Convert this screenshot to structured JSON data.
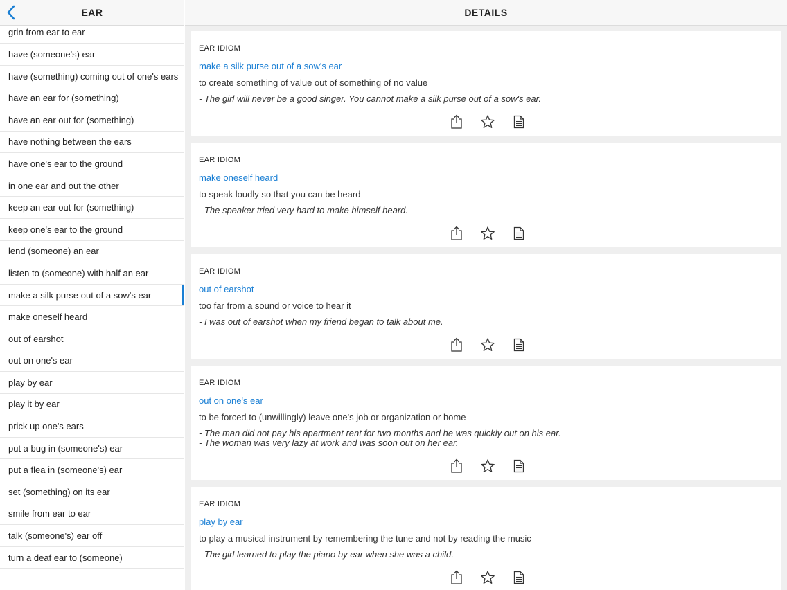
{
  "left_panel": {
    "title": "EAR",
    "items": [
      "grin from ear to ear",
      "have (someone's) ear",
      "have (something) coming out of one's ears",
      "have an ear for (something)",
      "have an ear out for (something)",
      "have nothing between the ears",
      "have one's ear to the ground",
      "in one ear and out the other",
      "keep an ear out for (something)",
      "keep one's ear to the ground",
      "lend (someone) an ear",
      "listen to (someone) with half an ear",
      "make a silk purse out of a sow's ear",
      "make oneself heard",
      "out of earshot",
      "out on one's ear",
      "play by ear",
      "play it by ear",
      "prick up one's ears",
      "put a bug in (someone's) ear",
      "put a flea in (someone's) ear",
      "set (something) on its ear",
      "smile from ear to ear",
      "talk (someone's) ear off",
      "turn a deaf ear to (someone)"
    ],
    "selected_index": 12
  },
  "right_panel": {
    "title": "DETAILS",
    "cards": [
      {
        "tag": "EAR IDIOM",
        "title": "make a silk purse out of a sow's ear",
        "definition": "to create something of value out of something of no value",
        "examples": [
          "- The girl will never be a good singer. You cannot make a silk purse out of a sow's ear."
        ]
      },
      {
        "tag": "EAR IDIOM",
        "title": "make oneself heard",
        "definition": "to speak loudly so that you can be heard",
        "examples": [
          "- The speaker tried very hard to make himself heard."
        ]
      },
      {
        "tag": "EAR IDIOM",
        "title": "out of earshot",
        "definition": "too far from a sound or voice to hear it",
        "examples": [
          "- I was out of earshot when my friend began to talk about me."
        ]
      },
      {
        "tag": "EAR IDIOM",
        "title": "out on one's ear",
        "definition": "to be forced to (unwillingly) leave one's job or organization or home",
        "examples": [
          "- The man did not pay his apartment rent for two months and he was quickly out on his ear.",
          "- The woman was very lazy at work and was soon out on her ear."
        ]
      },
      {
        "tag": "EAR IDIOM",
        "title": "play by ear",
        "definition": "to play a musical instrument by remembering the tune and not by reading the music",
        "examples": [
          "- The girl learned to play the piano by ear when she was a child."
        ]
      }
    ]
  },
  "icons": {
    "back": "chevron-left-icon",
    "share": "share-icon",
    "favorite": "star-icon",
    "note": "document-icon"
  },
  "colors": {
    "accent": "#1a7fd4",
    "header_bg": "#f7f7f7",
    "detail_bg": "#efefef"
  }
}
